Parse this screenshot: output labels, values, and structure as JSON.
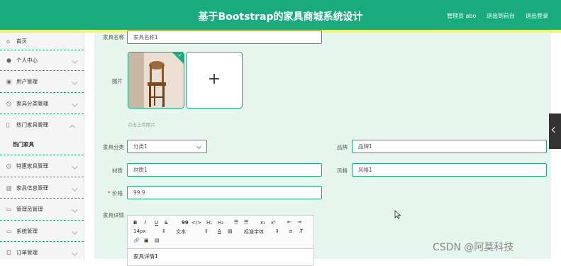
{
  "header": {
    "title": "基于Bootstrap的家具商城系统设计",
    "user": "管理员 abo",
    "back_to_front": "退出到前台",
    "logout": "退出登录",
    "accent": "#1aab7c"
  },
  "sidebar": {
    "items": [
      {
        "label": "首页",
        "icon": "home-icon"
      },
      {
        "label": "个人中心",
        "icon": "user-icon"
      },
      {
        "label": "用户管理",
        "icon": "users-icon"
      },
      {
        "label": "家具分类管理",
        "icon": "clock-icon"
      },
      {
        "label": "热门家具管理",
        "icon": "phone-icon"
      },
      {
        "label": "特惠家具管理",
        "icon": "clock-icon"
      },
      {
        "label": "家具信息管理",
        "icon": "building-icon"
      },
      {
        "label": "管理员管理",
        "icon": "monitor-icon"
      },
      {
        "label": "系统管理",
        "icon": "monitor-icon"
      },
      {
        "label": "订单管理",
        "icon": "order-icon"
      }
    ],
    "sub_item": "热门家具"
  },
  "form": {
    "name_label": "家具名称",
    "name_value": "家具名称1",
    "image_label": "图片",
    "upload_hint": "点击上传图片",
    "category_label": "家具分类",
    "category_value": "分类1",
    "brand_label": "品牌",
    "brand_value": "品牌1",
    "material_label": "材质",
    "material_value": "材质1",
    "style_label": "风格",
    "style_value": "风格1",
    "price_label": "价格",
    "price_required": "*",
    "price_value": "99.9",
    "detail_label": "家具详情",
    "detail_value": "家具详情1"
  },
  "editor": {
    "bold": "B",
    "italic": "I",
    "underline": "U",
    "strike": "S",
    "quote": "99",
    "code": "</>",
    "h1": "H₁",
    "h2": "H₂",
    "sub": "x₁",
    "sup": "x²",
    "size": "14px",
    "text": "文本",
    "font": "标准字体"
  },
  "watermark": "CSDN @阿莫科技"
}
